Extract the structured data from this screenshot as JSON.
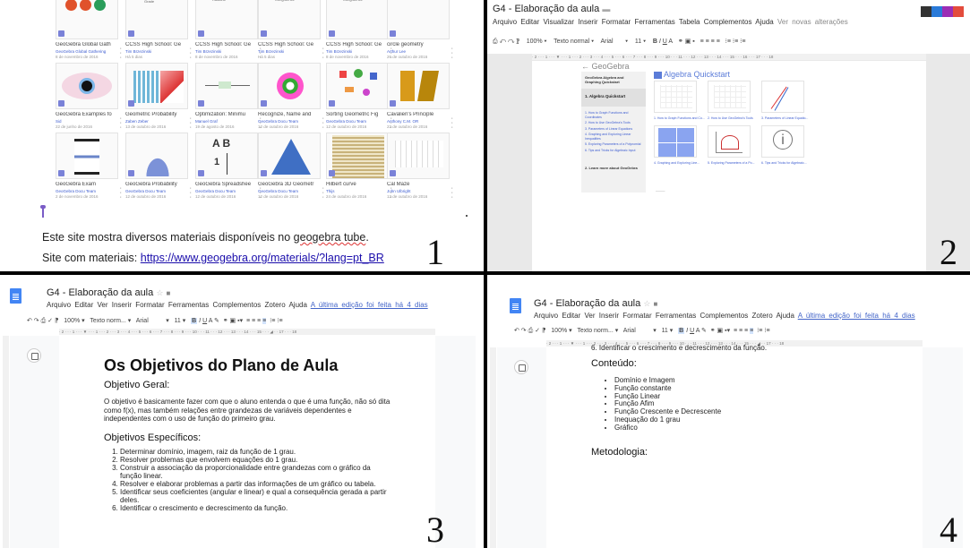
{
  "panel1": {
    "number": "1",
    "cards": [
      {
        "title": "GeoGebra Global Gath",
        "author": "GeoGebra Global Gathering",
        "date": "8 de novembro de 2016"
      },
      {
        "title": "CCSS High School: Ge",
        "author": "Tim Brzezinski",
        "date": "Há 5 dias"
      },
      {
        "title": "CCSS High School: Ge",
        "author": "Tim Brzezinski",
        "date": "8 de novembro de 2016"
      },
      {
        "title": "CCSS High School: Ge",
        "author": "Tim Brzezinski",
        "date": "Há 5 dias"
      },
      {
        "title": "CCSS High School: Ge",
        "author": "Tim Brzezinski",
        "date": "8 de novembro de 2016"
      },
      {
        "title": "circle geometry",
        "author": "Arthur Lee",
        "date": "26 de outubro de 2016"
      },
      {
        "title": "GeoGebra Examples fo",
        "author": "Sid",
        "date": "22 de junho de 2016"
      },
      {
        "title": "Geometric Probability",
        "author": "Zaben Zeber",
        "date": "13 de outubro de 2016"
      },
      {
        "title": "Optimization: Minimu",
        "author": "Manuel Graf",
        "date": "19 de agosto de 2016"
      },
      {
        "title": "Recognize, Name and",
        "author": "GeoGebra Docu Team",
        "date": "12 de outubro de 2016"
      },
      {
        "title": "Sorting Geometric Fig",
        "author": "GeoGebra Docu Team",
        "date": "12 de outubro de 2016"
      },
      {
        "title": "Cavalieri's Principle",
        "author": "Anthony C.M. OR",
        "date": "22 de outubro de 2016"
      },
      {
        "title": "GeoGebra Exam",
        "author": "GeoGebra Docu Team",
        "date": "2 de novembro de 2016"
      },
      {
        "title": "GeoGebra Probability",
        "author": "GeoGebra Docu Team",
        "date": "12 de outubro de 2016"
      },
      {
        "title": "GeoGebra Spreadshee",
        "author": "GeoGebra Docu Team",
        "date": "12 de outubro de 2016"
      },
      {
        "title": "GeoGebra 3D Geometr",
        "author": "GeoGebra Docu Team",
        "date": "12 de outubro de 2016"
      },
      {
        "title": "Hilbert curve",
        "author": "Thijs",
        "date": "24 de outubro de 2016"
      },
      {
        "title": "Cal Maze",
        "author": "John Ulbright",
        "date": "12 de outubro de 2016"
      }
    ],
    "line1_pre": "Este site mostra diversos materiais disponíveis no ",
    "line1_link": "geogebra tube",
    "line1_post": ".",
    "line2_pre": "Site com materiais: ",
    "line2_link": "https://www.geogebra.org/materials/?lang=pt_BR"
  },
  "panel2": {
    "number": "2",
    "doc_title": "G4 - Elaboração da aula",
    "menu": [
      "Arquivo",
      "Editar",
      "Visualizar",
      "Inserir",
      "Formatar",
      "Ferramentas",
      "Tabela",
      "Complementos",
      "Ajuda"
    ],
    "changes_link": "Ver novas alterações",
    "zoom": "100%",
    "style": "Texto normal",
    "font": "Arial",
    "size": "11",
    "quick_header": "Algebra Quickstart",
    "geogebra_logo": "GeoGebra",
    "menu_title": "GeoGebra Algebra and Graphing Quickstart",
    "menu_section": "1. Algebra Quickstart",
    "menu_items": [
      "1. How to Graph Functions and Coordinates",
      "2. How to Use GeoGebra's Tools",
      "3. Parameters of Linear Equations",
      "4. Graphing and Exploring Linear Inequalities",
      "5. Exploring Parameters of a Polynomial",
      "6. Tips and Tricks for Algebraic Input"
    ],
    "menu_section2": "2. Learn more about GeoGebra",
    "captions": [
      "1. How to Graph Functions and Co...",
      "2. How to Use GeoGebra's Tools",
      "3. Parameters of Linear Equatio...",
      "4. Graphing and Exploring Line...",
      "5. Exploring Parameters of a Po...",
      "6. Tips and Tricks for Algebraic..."
    ],
    "info_glyph": "i"
  },
  "panel3": {
    "number": "3",
    "doc_title": "G4 - Elaboração da aula",
    "menu": [
      "Arquivo",
      "Editar",
      "Ver",
      "Inserir",
      "Formatar",
      "Ferramentas",
      "Complementos",
      "Zotero",
      "Ajuda"
    ],
    "last_edit": "A última edição foi feita há 4 dias",
    "zoom": "100%",
    "style": "Texto norm...",
    "font": "Arial",
    "size": "11",
    "heading": "Os Objetivos do Plano de Aula",
    "sub1": "Objetivo Geral:",
    "para": "O objetivo é basicamente fazer com que o aluno entenda o que é uma função, não só dita como f(x), mas também relações entre grandezas de variáveis dependentes e independentes com o uso de função do primeiro grau.",
    "sub2": "Objetivos Específicos:",
    "items": [
      "Determinar domínio, imagem, raiz da função de 1 grau.",
      "Resolver problemas que envolvem equações do 1 grau.",
      "Construir a associação da proporcionalidade entre grandezas com o gráfico da função linear.",
      "Resolver e elaborar problemas a partir das informações de um gráfico ou tabela.",
      "Identificar seus coeficientes (angular e linear) e qual a consequência gerada a partir deles.",
      "Identificar o crescimento e decrescimento da função."
    ]
  },
  "panel4": {
    "number": "4",
    "doc_title": "G4 - Elaboração da aula",
    "menu": [
      "Arquivo",
      "Editar",
      "Ver",
      "Inserir",
      "Formatar",
      "Ferramentas",
      "Complementos",
      "Zotero",
      "Ajuda"
    ],
    "last_edit": "A última edição foi feita há 4 dias",
    "zoom": "100%",
    "style": "Texto norm...",
    "font": "Arial",
    "size": "11",
    "cut_line": "6.  Identificar o crescimento e decrescimento da função.",
    "sub1": "Conteúdo:",
    "items": [
      "Domínio e Imagem",
      "Função constante",
      "Função Linear",
      "Função Afim",
      "Função Crescente e Decrescente",
      "Inequação do 1 grau",
      "Gráfico"
    ],
    "sub2": "Metodologia:"
  }
}
